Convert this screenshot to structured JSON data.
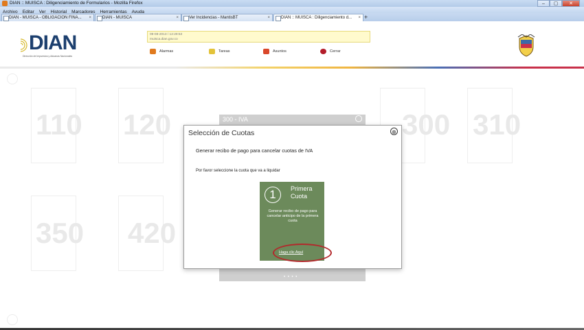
{
  "window": {
    "title": "DIAN :: MUISCA : Diligenciamiento de Formularios - Mozilla Firefox",
    "buttons": [
      "–",
      "▢",
      "✕"
    ]
  },
  "menu": [
    "Archivo",
    "Editar",
    "Ver",
    "Historial",
    "Marcadores",
    "Herramientas",
    "Ayuda"
  ],
  "tabs": [
    {
      "label": "DIAN - MUISCA - OBLIGACION FINA..."
    },
    {
      "label": "DIAN - MUISCA"
    },
    {
      "label": "Ver Incidencias - MantisBT"
    },
    {
      "label": "DIAN :: MUISCA : Diligenciamiento d..."
    }
  ],
  "newtab": "+",
  "header": {
    "logo": "DIAN",
    "logo_sub": "Dirección de Impuestos y Aduanas Nacionales",
    "info_line1": "09-08-2013 / 12:29:53",
    "info_line2": "muisca.dian.gov.co",
    "nav": [
      {
        "label": "Alarmas",
        "color": "#e07a1e"
      },
      {
        "label": "Tareas",
        "color": "#e3c33a"
      },
      {
        "label": "Asuntos",
        "color": "#d9472a"
      },
      {
        "label": "Cerrar",
        "color": "#b31d2a"
      }
    ]
  },
  "background_numbers": [
    "110",
    "120",
    "300",
    "310",
    "350",
    "420"
  ],
  "popup_bg": {
    "title": "300 - IVA",
    "dots": "• • • •"
  },
  "dialog": {
    "title": "Selección de Cuotas",
    "close": "⊗",
    "line1": "Generar recibo de pago para cancelar cuotas de IVA",
    "line2": "Por favor seleccione la cuota que va a liquidar",
    "tile": {
      "number": "1",
      "label1": "Primera",
      "label2": "Cuota",
      "desc": "Generar recibo de pago para cancelar anticipo de la primera cuota",
      "link": "Haga clic Aquí",
      "color": "#6c8a5b"
    }
  }
}
